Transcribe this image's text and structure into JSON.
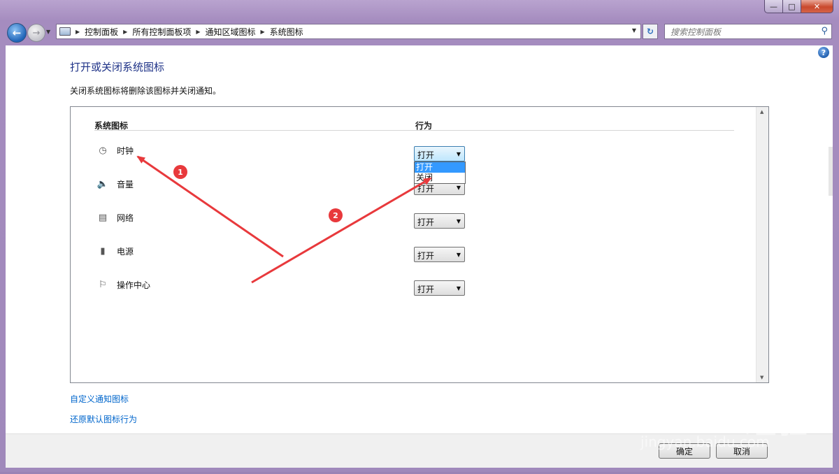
{
  "window": {
    "caption": {
      "min": "—",
      "max": "□",
      "close": "✕"
    }
  },
  "nav": {
    "back_icon": "←",
    "forward_icon": "→",
    "breadcrumbs": [
      "控制面板",
      "所有控制面板项",
      "通知区域图标",
      "系统图标"
    ],
    "search_placeholder": "搜索控制面板"
  },
  "page": {
    "title": "打开或关闭系统图标",
    "description": "关闭系统图标将删除该图标并关闭通知。",
    "columns": {
      "icon": "系统图标",
      "behavior": "行为"
    },
    "rows": [
      {
        "label": "时钟",
        "icon": "clock-icon",
        "glyph": "◷",
        "value": "打开"
      },
      {
        "label": "音量",
        "icon": "volume-icon",
        "glyph": "🔈",
        "value": "打开"
      },
      {
        "label": "网络",
        "icon": "network-icon",
        "glyph": "▤",
        "value": "打开"
      },
      {
        "label": "电源",
        "icon": "power-icon",
        "glyph": "▮",
        "value": "打开"
      },
      {
        "label": "操作中心",
        "icon": "flag-icon",
        "glyph": "⚐",
        "value": "打开"
      }
    ],
    "dropdown_options": [
      "打开",
      "关闭"
    ],
    "dropdown_selected": "打开",
    "links": {
      "customize": "自定义通知图标",
      "restore": "还原默认图标行为"
    }
  },
  "footer": {
    "ok": "确定",
    "cancel": "取消"
  },
  "annotations": {
    "step1": "1",
    "step2": "2",
    "color": "#e8393c"
  },
  "watermark": {
    "logo": "Baidu经验",
    "url": "jingyan.baidu.com"
  }
}
